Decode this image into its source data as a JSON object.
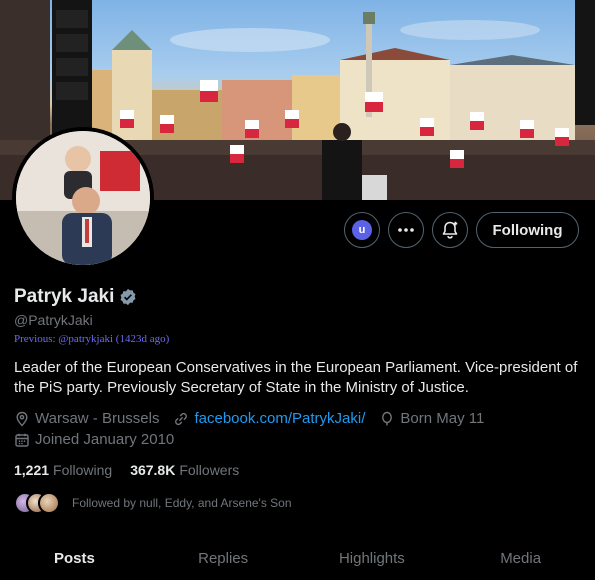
{
  "profile": {
    "name": "Patryk Jaki",
    "handle": "@PatrykJaki",
    "previous": "Previous: @patrykjaki (1423d ago)",
    "bio": "Leader of the European Conservatives in the European Parliament. Vice-president of the PiS party. Previously Secretary of State in the Ministry of Justice.",
    "location": "Warsaw - Brussels",
    "website": "facebook.com/PatrykJaki/",
    "birthday": "Born May 11",
    "joined": "Joined January 2010",
    "verified": true
  },
  "actions": {
    "subscribe_letter": "u",
    "following_label": "Following"
  },
  "stats": {
    "following_count": "1,221",
    "following_label": "Following",
    "followers_count": "367.8K",
    "followers_label": "Followers"
  },
  "followed_by": "Followed by null, Eddy, and Arsene's Son",
  "tabs": [
    "Posts",
    "Replies",
    "Highlights",
    "Media"
  ],
  "active_tab": "Posts",
  "colors": {
    "background": "#000000",
    "link": "#1d9bf0",
    "muted": "#71767b",
    "verified_badge": "#829aab",
    "subscribe_badge": "#5c62e6"
  },
  "icons": [
    "subscribe-icon",
    "more-icon",
    "notification-bell-icon",
    "verified-badge-icon",
    "location-icon",
    "link-icon",
    "birthday-icon",
    "calendar-icon"
  ]
}
